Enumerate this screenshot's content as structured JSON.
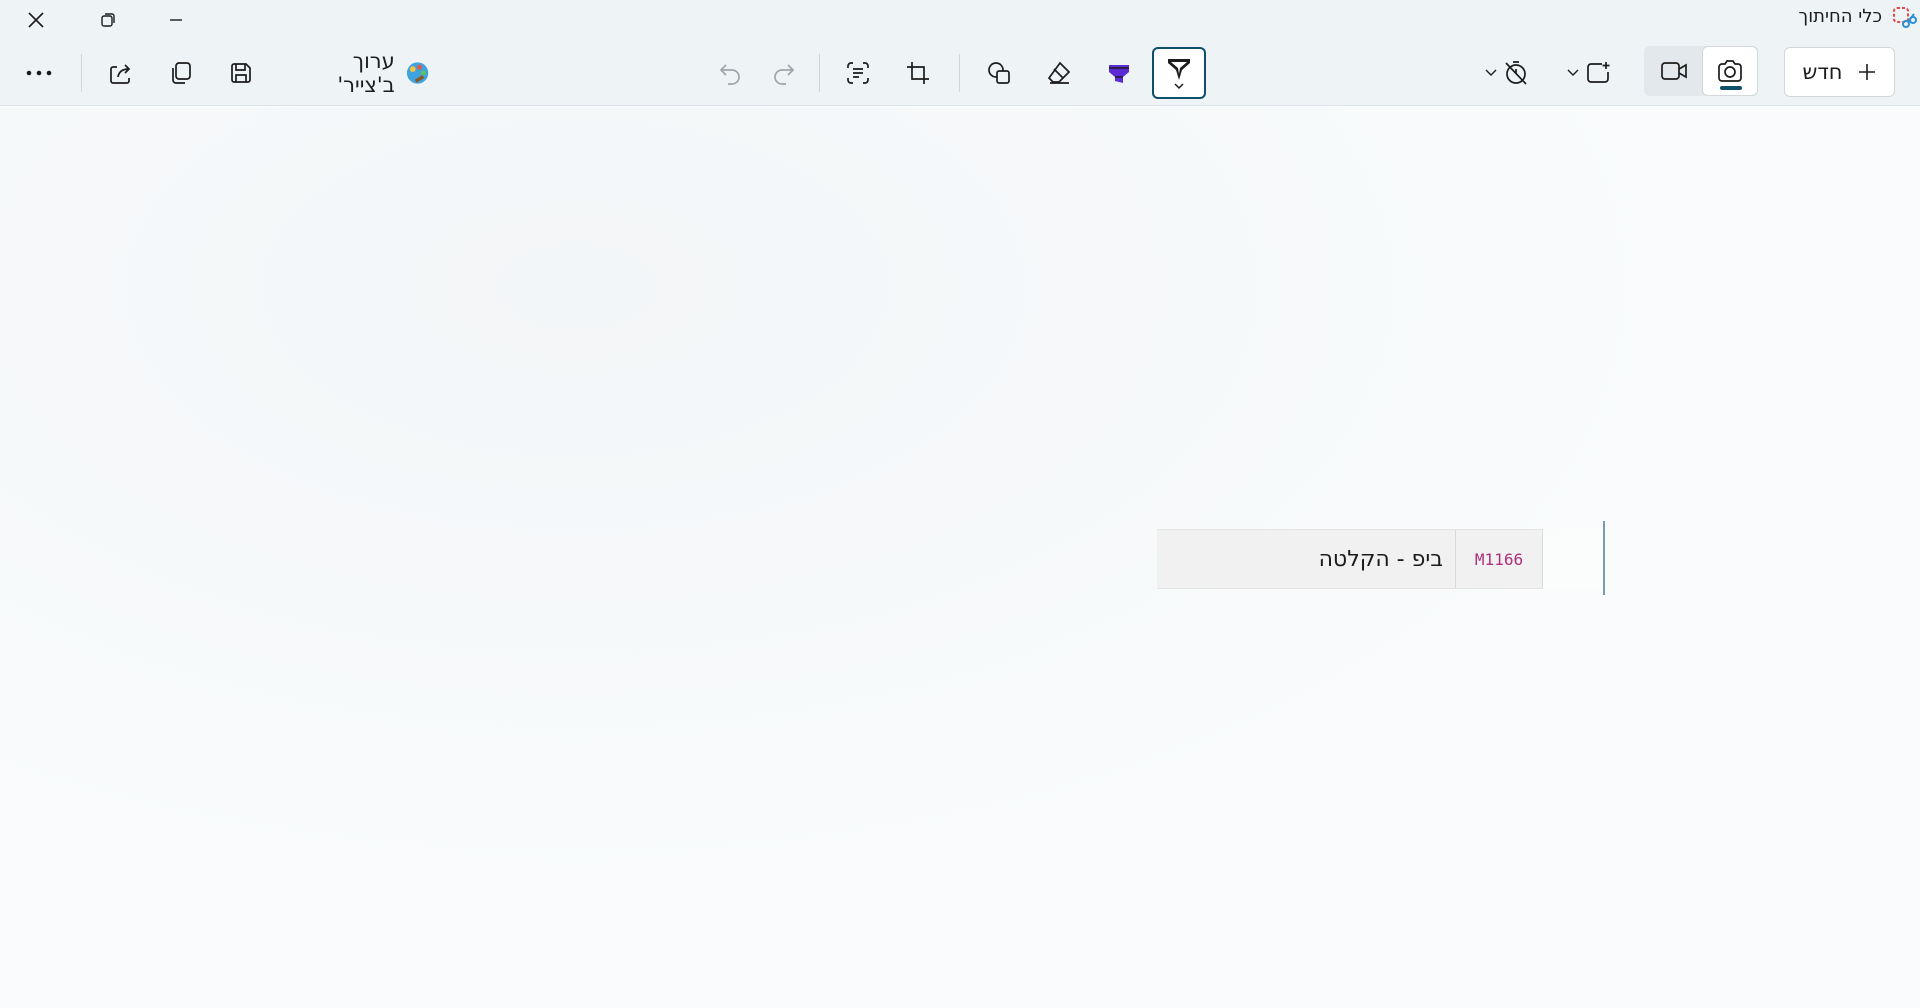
{
  "window": {
    "title": "כלי החיתוך"
  },
  "toolbar": {
    "edit_in_paint": "ערוך ב'צייר'",
    "new_label": "חדש",
    "icons": {
      "more": "more-icon",
      "share": "share-icon",
      "copy": "copy-icon",
      "save": "save-icon",
      "undo": "undo-icon",
      "redo": "redo-icon",
      "text_actions": "text-actions-icon",
      "crop": "crop-icon",
      "shapes": "shapes-icon",
      "eraser": "eraser-icon",
      "highlighter": "highlighter-icon",
      "ballpoint_pen": "pen-icon",
      "delay": "timer-off-icon",
      "snip_mode": "snip-mode-icon",
      "video": "video-icon",
      "screenshot": "camera-icon"
    }
  },
  "canvas": {
    "snip_code": "M1166",
    "snip_text": "ביפ - הקלטה"
  },
  "colors": {
    "accent": "#0e4f6b",
    "highlighter": "#5b2bd6",
    "code_text": "#b0307a"
  }
}
